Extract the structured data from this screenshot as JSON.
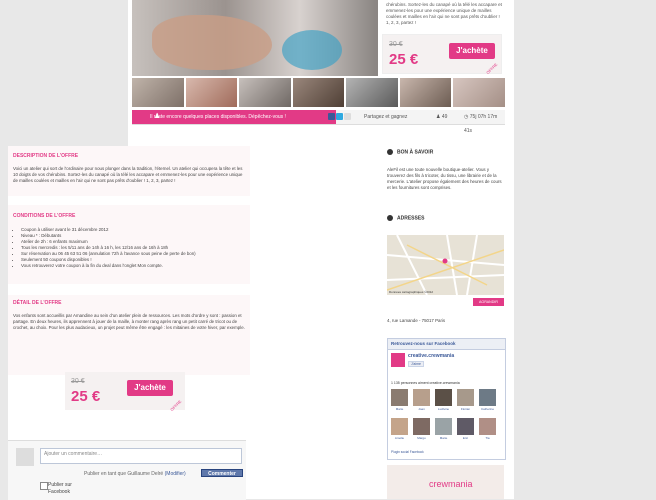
{
  "offer": {
    "description_short": "chérubins. Sortez-les du canapé où la télé les accapare et emmenez-les pour une expérience unique de mailles coulées et mailles en l'air qui ne sont pas prêts d'oublier ! 1, 2, 3, partez !",
    "old_price": "30 €",
    "new_price": "25 €",
    "buy_label": "J'achète",
    "tag": "OFFRE"
  },
  "status_bar": {
    "places_text": "Il reste encore quelques places disponibles. Dépêchez-vous !",
    "share_label": "Partagez et gagnez",
    "share_count": "49",
    "timer": "75j 07h 17m 41s"
  },
  "sections": {
    "description": {
      "title": "DESCRIPTION DE L'OFFRE",
      "text": "Voici un atelier qui sort de l'ordinaire pour nous plonger dans la tradition, l'éternel. Un atelier qui occupera la tête et les 10 doigts de vos chérubins. Sortez-les du canapé où la télé les accapare et emmenez-les pour une expérience unique de mailles coulées et mailles en l'air qui ne sont pas prêts d'oublier ! 1, 2, 3, partez !"
    },
    "conditions": {
      "title": "CONDITIONS DE L'OFFRE",
      "items": [
        "Coupon à utiliser avant le 31 décembre 2012",
        "Niveau * : Débutants",
        "Atelier de 2h : 6 enfants maximum",
        "Tous les mercredis : les 5/11 ans de 14h à 16 h, les 12/16 ans de 16h à 18h",
        "Sur réservation au 06 45 63 51 06 (annulation 72h à l'avance sous peine de perte de bon)",
        "Seulement 50 coupons disponibles !",
        "Vous retrouverez votre coupon à la fin du deal dans l'onglet Mon compte."
      ]
    },
    "detail": {
      "title": "DÉTAIL DE L'OFFRE",
      "text": "Vos enfants sont accueillis par Amandine au sein d'un atelier plein de ressources. Les mots d'ordre y sont : passion et partage. En deux heures, ils apprennent à jouer de la maille, à monter rang après rang un petit carré de tricot ou de crochet, au choix. Pour les plus audacieux, un projet peut même être engagé : les mitaines de votre hiver, par exemple."
    }
  },
  "bottom_price": {
    "old_price": "30 €",
    "new_price": "25 €",
    "buy_label": "J'achète",
    "tag": "OFFRE"
  },
  "sidebar": {
    "know_title": "BON À SAVOIR",
    "know_text": "AleFil est une toute nouvelle boutique-atelier. Vous y trouverez des fils à tricoter, du tissu, une librairie et de la mercerie. L'atelier propose également des heures de cours et les fournitures sont comprises.",
    "address_title": "ADRESSES",
    "map_caption": "Données cartographiques ©2012",
    "agrandir": "AGRANDIR",
    "address": "4, rue Lamande - 75017 Paris",
    "fb_title": "Retrouvez-nous sur Facebook",
    "fb_page": "creative.crewmania",
    "fb_like": "J'aime",
    "fb_fans": "1 135 personnes aiment creative.crewmania",
    "fb_names": [
      "Marie",
      "Joan",
      "Ludivine",
      "Florian",
      "Catherine",
      "Amélie",
      "Margo",
      "Marie",
      "Eric",
      "Tia"
    ],
    "fb_plugin": "Plugin social Facebook",
    "crew_brand": "crewmania"
  },
  "comment": {
    "placeholder": "Ajouter un commentaire…",
    "publish_as": "Publier en tant que Guillaume Delré",
    "modify": "(Modifier)",
    "submit": "Commenter",
    "publish_fb": "Publier sur Facebook"
  },
  "colors": {
    "accent": "#e23a86",
    "facebook": "#3b5998"
  }
}
